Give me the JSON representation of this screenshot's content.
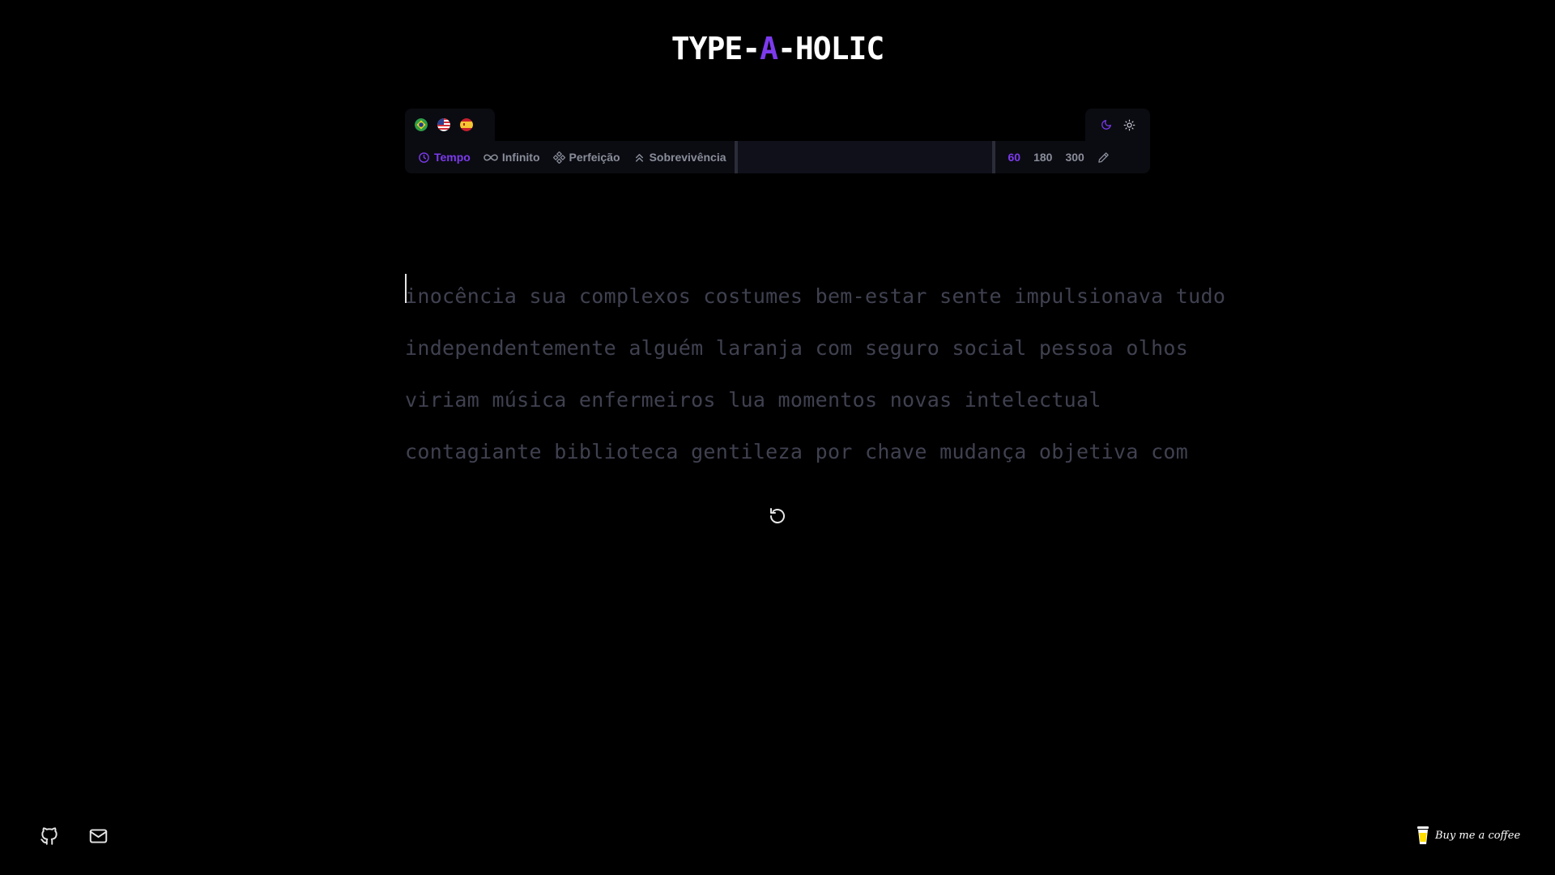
{
  "app": {
    "logo_prefix": "TYPE-",
    "logo_accent": "A",
    "logo_suffix": "-HOLIC",
    "accent_color": "#7c3aed"
  },
  "languages": [
    {
      "icon": "brazil-flag-icon"
    },
    {
      "icon": "us-flag-icon"
    },
    {
      "icon": "spain-flag-icon"
    }
  ],
  "theme": {
    "dark_icon": "moon-icon",
    "light_icon": "sun-icon"
  },
  "modes": [
    {
      "label": "Tempo",
      "icon": "clock-icon",
      "active": true
    },
    {
      "label": "Infinito",
      "icon": "infinity-icon",
      "active": false
    },
    {
      "label": "Perfeição",
      "icon": "diamond-icon",
      "active": false
    },
    {
      "label": "Sobrevivência",
      "icon": "chevrons-up-icon",
      "active": false
    }
  ],
  "durations": [
    {
      "label": "60",
      "active": true
    },
    {
      "label": "180",
      "active": false
    },
    {
      "label": "300",
      "active": false
    }
  ],
  "edit_icon": "pencil-icon",
  "words": {
    "lines": [
      "inocência sua complexos costumes bem-estar sente impulsionava tudo",
      "independentemente alguém laranja com seguro social pessoa olhos",
      "viriam música enfermeiros lua momentos novas intelectual",
      "contagiante biblioteca gentileza por chave mudança objetiva com"
    ]
  },
  "restart_icon": "restart-icon",
  "footer": {
    "github_icon": "github-icon",
    "mail_icon": "mail-icon",
    "coffee_label": "Buy me a coffee",
    "coffee_icon": "coffee-cup-icon"
  }
}
